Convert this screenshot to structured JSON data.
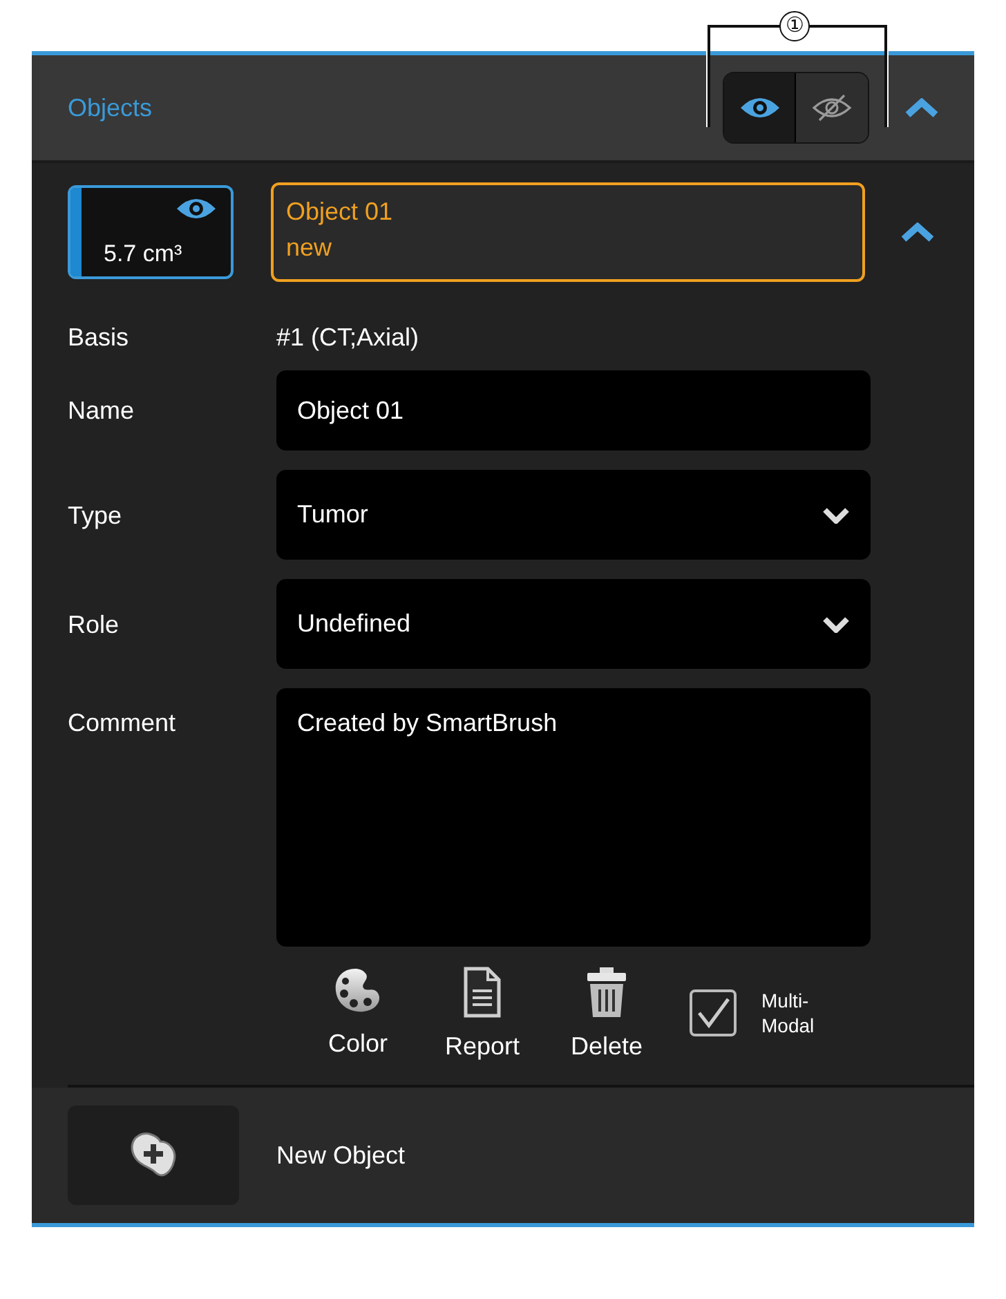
{
  "callout": "①",
  "header": {
    "title": "Objects",
    "view_toggle": [
      {
        "kind": "show",
        "selected": true
      },
      {
        "kind": "hide",
        "selected": false
      }
    ],
    "expanded": true
  },
  "object": {
    "volume": "5.7 cm³",
    "visible": true,
    "color": "#1e88d0",
    "name": "Object 01",
    "status": "new",
    "expanded": true
  },
  "fields": [
    {
      "kind": "text",
      "label": "Basis",
      "value": "#1 (CT;Axial)"
    },
    {
      "kind": "input",
      "label": "Name",
      "value": "Object 01"
    },
    {
      "kind": "select",
      "label": "Type",
      "value": "Tumor"
    },
    {
      "kind": "select",
      "label": "Role",
      "value": "Undefined"
    },
    {
      "kind": "textarea",
      "label": "Comment",
      "value": "Created by SmartBrush"
    }
  ],
  "actions": [
    {
      "kind": "palette",
      "label": "Color"
    },
    {
      "kind": "document",
      "label": "Report"
    },
    {
      "kind": "trash",
      "label": "Delete"
    }
  ],
  "multimodal": {
    "label": "Multi-Modal",
    "checked": true
  },
  "footer": {
    "button_label": "New Object"
  }
}
